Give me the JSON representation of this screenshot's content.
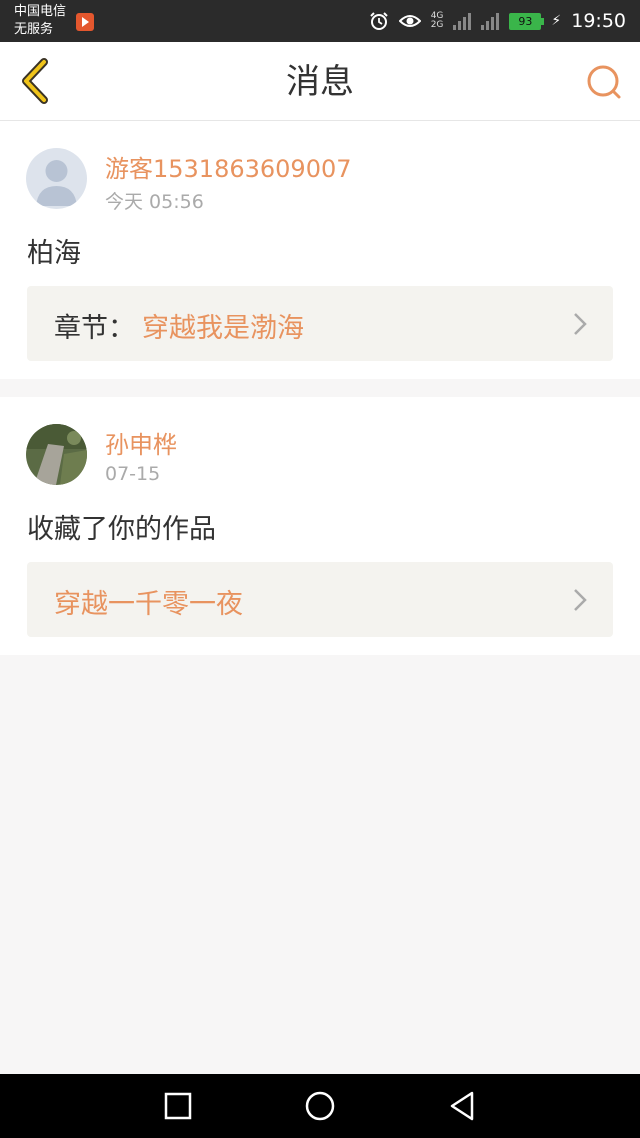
{
  "status_bar": {
    "carrier_line1": "中国电信",
    "carrier_line2": "无服务",
    "network_top": "4G",
    "network_bottom": "2G",
    "battery": "93",
    "time": "19:50"
  },
  "header": {
    "title": "消息",
    "back_icon": "chevron-left-icon",
    "search_icon": "search-icon",
    "accent_color": "#e8935f"
  },
  "messages": [
    {
      "username": "游客1531863609007",
      "time": "今天 05:56",
      "content": "柏海",
      "link_prefix": "章节：",
      "link_text": "穿越我是渤海",
      "avatar": "default-avatar"
    },
    {
      "username": "孙申桦",
      "time": "07-15",
      "content": "收藏了你的作品",
      "link_prefix": "",
      "link_text": "穿越一千零一夜",
      "avatar": "photo-avatar"
    }
  ],
  "nav_bar": {
    "recent_icon": "square-icon",
    "home_icon": "circle-icon",
    "back_icon": "triangle-back-icon"
  }
}
